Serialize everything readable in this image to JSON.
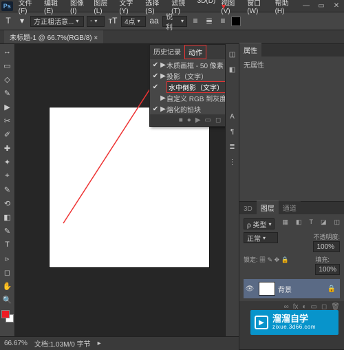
{
  "menu": [
    "文件(F)",
    "编辑(E)",
    "图像(I)",
    "图层(L)",
    "文字(Y)",
    "选择(S)",
    "滤镜(T)",
    "3D(D)",
    "视图(V)",
    "窗口(W)",
    "帮助(H)"
  ],
  "options_bar": {
    "tool_glyph": "T",
    "font_family": "方正粗活意...",
    "font_style": "-",
    "font_size": "4点",
    "aa_label": "aa",
    "anti_alias": "锐利"
  },
  "document_tab": "未标题-1 @ 66.7%(RGB/8)",
  "tools": [
    "↔",
    "▭",
    "◇",
    "✎",
    "▶",
    "✂",
    "✐",
    "✚",
    "✦",
    "⌖",
    "✎",
    "⟲",
    "◧",
    "✎",
    "T",
    "▹",
    "◻",
    "✋",
    "🔍"
  ],
  "history_panel": {
    "tab_history": "历史记录",
    "tab_actions": "动作",
    "rows": [
      {
        "check": "✔",
        "bullet": "▶",
        "label": "木质画框 - 50 像素"
      },
      {
        "check": "✔",
        "bullet": "▶",
        "label": "投影（文字）"
      },
      {
        "check": "✔",
        "bullet": "",
        "label": "水中倒影（文字）"
      },
      {
        "check": "",
        "bullet": "▶",
        "label": "自定义 RGB 到灰度"
      },
      {
        "check": "✔",
        "bullet": "▶",
        "label": "熔化的铅块"
      }
    ]
  },
  "mid_strip_icons": [
    "◫",
    "◧",
    "A",
    "¶",
    "≣",
    "⋮"
  ],
  "properties_panel": {
    "tab": "属性",
    "body": "无属性"
  },
  "layers_panel": {
    "tabs": [
      "3D",
      "图层",
      "通道"
    ],
    "kind_label": "ρ 类型",
    "kind_icons": [
      "▦",
      "◧",
      "T",
      "◪",
      "◫"
    ],
    "blend_mode": "正常",
    "opacity_label": "不透明度:",
    "opacity_value": "100%",
    "lock_label": "锁定:",
    "lock_icons": "▦ ✎ ✥ 🔒",
    "fill_label": "填充:",
    "fill_value": "100%",
    "layer_name": "背景",
    "eye": "👁",
    "footer_icons": [
      "∞",
      "fx",
      "◐",
      "▭",
      "◻",
      "🗑"
    ]
  },
  "status_bar": {
    "zoom": "66.67%",
    "info": "文档:1.03M/0 字节"
  },
  "watermark": {
    "title": "溜溜自学",
    "sub": "zixue.3d66.com",
    "play": "▶"
  },
  "colors": {
    "accent_red": "#e33",
    "brand_blue": "#0894cb"
  }
}
